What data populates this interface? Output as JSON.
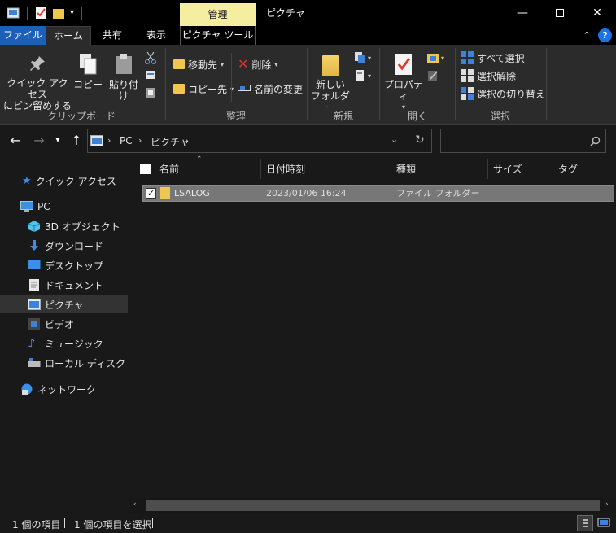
{
  "window": {
    "title": "ピクチャ",
    "context_tab_label": "管理"
  },
  "ribbon_tabs": {
    "file": "ファイル",
    "home": "ホーム",
    "share": "共有",
    "view": "表示",
    "picture_tools": "ピクチャ ツール"
  },
  "ribbon": {
    "clipboard": {
      "pin_line1": "クイック アクセス",
      "pin_line2": "にピン留めする",
      "copy": "コピー",
      "paste": "貼り付け",
      "group": "クリップボード"
    },
    "organize": {
      "move_to": "移動先",
      "copy_to": "コピー先",
      "delete": "削除",
      "rename": "名前の変更",
      "group": "整理"
    },
    "new": {
      "new_folder_line1": "新しい",
      "new_folder_line2": "フォルダー",
      "group": "新規"
    },
    "open": {
      "properties": "プロパティ",
      "group": "開く"
    },
    "select": {
      "select_all": "すべて選択",
      "select_none": "選択解除",
      "invert_selection": "選択の切り替え",
      "group": "選択"
    }
  },
  "address": {
    "crumbs": [
      "PC",
      "ピクチャ"
    ]
  },
  "nav_pane": {
    "quick_access": "クイック アクセス",
    "pc": "PC",
    "items": [
      "3D オブジェクト",
      "ダウンロード",
      "デスクトップ",
      "ドキュメント",
      "ピクチャ",
      "ビデオ",
      "ミュージック",
      "ローカル ディスク (C:)"
    ],
    "network": "ネットワーク"
  },
  "columns": {
    "name": "名前",
    "date": "日付時刻",
    "type": "種類",
    "size": "サイズ",
    "tags": "タグ"
  },
  "files": [
    {
      "name": "LSALOG",
      "date": "2023/01/06 16:24",
      "type": "ファイル フォルダー",
      "size": "",
      "tags": ""
    }
  ],
  "status": {
    "item_count": "1 個の項目",
    "selected_count": "1 個の項目を選択"
  },
  "colors": {
    "file_tab": "#1c5fb8",
    "context_tab": "#f5eda0",
    "help": "#1a73e8",
    "folder": "#f0c64f",
    "selected_row": "#777777"
  }
}
